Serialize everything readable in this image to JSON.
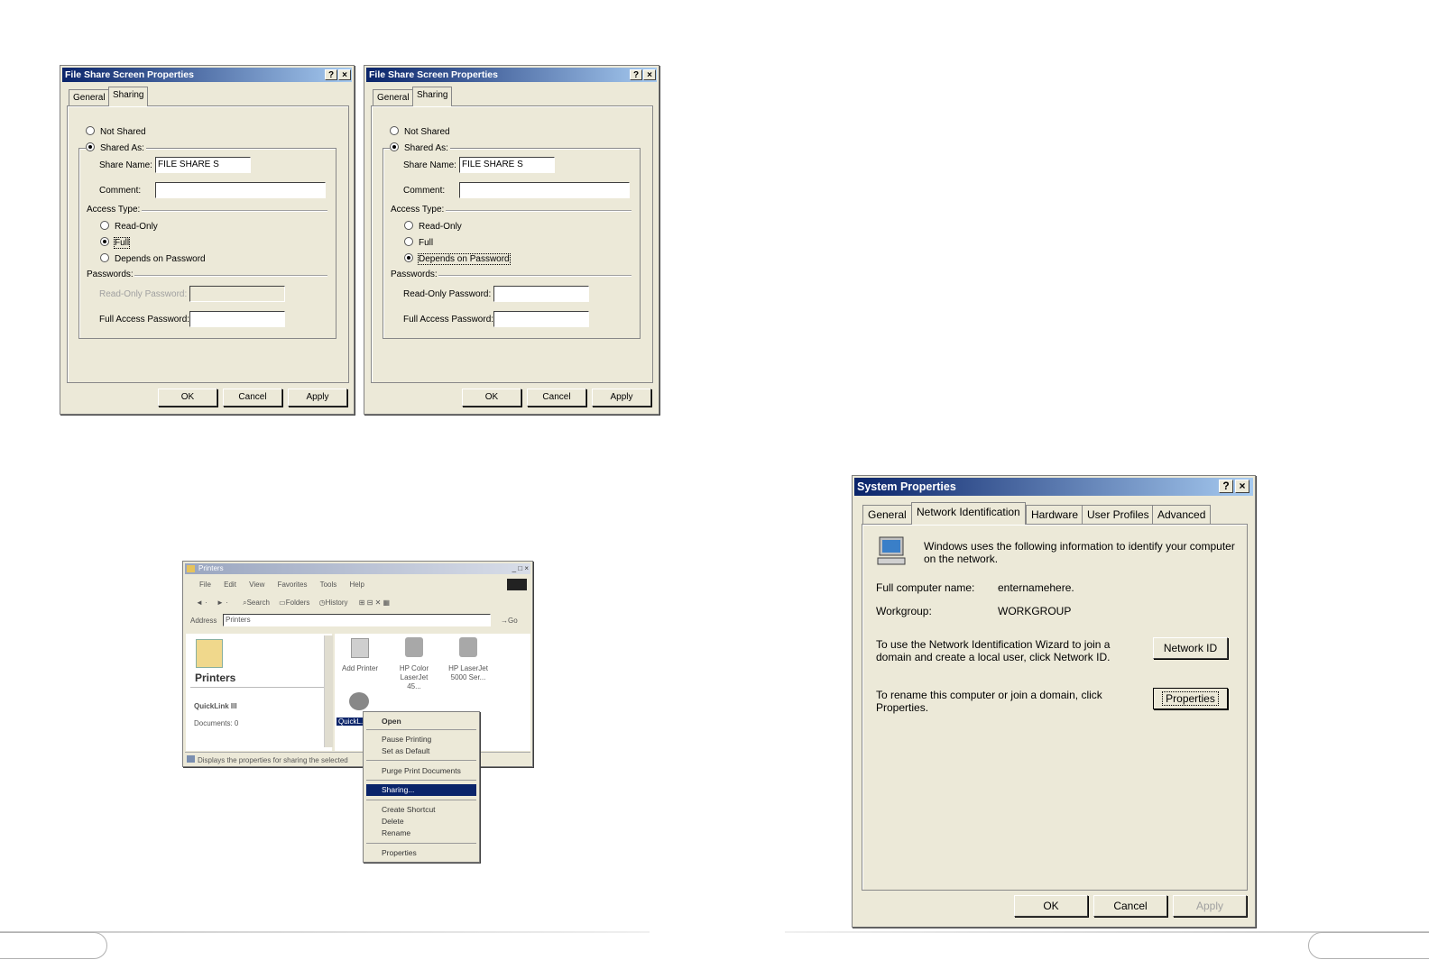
{
  "dialog_left": {
    "title": "File Share Screen Properties",
    "help_btn": "?",
    "close_btn": "×",
    "tabs": [
      "General",
      "Sharing"
    ],
    "not_shared": "Not Shared",
    "shared_as": "Shared As:",
    "share_name_label": "Share Name:",
    "share_name_value": "FILE SHARE S",
    "comment_label": "Comment:",
    "comment_value": "",
    "access_type_label": "Access Type:",
    "read_only": "Read-Only",
    "full": "Full",
    "depends": "Depends on Password",
    "passwords_label": "Passwords:",
    "ro_password_label": "Read-Only Password:",
    "full_password_label": "Full Access Password:",
    "selected_share": "Shared As:",
    "selected_access": "Full",
    "ok": "OK",
    "cancel": "Cancel",
    "apply": "Apply"
  },
  "dialog_right": {
    "title": "File Share Screen Properties",
    "help_btn": "?",
    "close_btn": "×",
    "tabs": [
      "General",
      "Sharing"
    ],
    "not_shared": "Not Shared",
    "shared_as": "Shared As:",
    "share_name_label": "Share Name:",
    "share_name_value": "FILE SHARE S",
    "comment_label": "Comment:",
    "comment_value": "",
    "access_type_label": "Access Type:",
    "read_only": "Read-Only",
    "full": "Full",
    "depends": "Depends on Password",
    "passwords_label": "Passwords:",
    "ro_password_label": "Read-Only Password:",
    "full_password_label": "Full Access Password:",
    "selected_share": "Shared As:",
    "selected_access": "Depends on Password",
    "ok": "OK",
    "cancel": "Cancel",
    "apply": "Apply"
  },
  "explorer": {
    "title": "Printers",
    "menu": [
      "File",
      "Edit",
      "View",
      "Favorites",
      "Tools",
      "Help"
    ],
    "toolbar": [
      "Search",
      "Folders",
      "History"
    ],
    "address_label": "Address",
    "address_value": "Printers",
    "go": "Go",
    "left_heading": "Printers",
    "left_item": "QuickLink III",
    "left_docs": "Documents: 0",
    "icons": [
      "Add Printer",
      "HP Color LaserJet 45...",
      "HP LaserJet 5000 Ser...",
      "QuickL..."
    ],
    "status": "Displays the properties for sharing the selected",
    "context_menu": [
      "Open",
      "Pause Printing",
      "Set as Default",
      "Purge Print Documents",
      "Sharing...",
      "Create Shortcut",
      "Delete",
      "Rename",
      "Properties"
    ],
    "highlighted": "Sharing..."
  },
  "system_properties": {
    "title": "System Properties",
    "help_btn": "?",
    "close_btn": "×",
    "tabs": [
      "General",
      "Network Identification",
      "Hardware",
      "User Profiles",
      "Advanced"
    ],
    "active_tab": "Network Identification",
    "intro_line1": "Windows uses the following information to identify your computer",
    "intro_line2": "on the network.",
    "full_name_label": "Full computer name:",
    "full_name_value": "enternamehere.",
    "workgroup_label": "Workgroup:",
    "workgroup_value": "WORKGROUP",
    "wizard_line1": "To use the Network Identification Wizard to join a",
    "wizard_line2": "domain and create a local user, click Network ID.",
    "network_id_btn": "Network ID",
    "rename_line1": "To rename this computer or join a domain, click",
    "rename_line2": "Properties.",
    "properties_btn": "Properties",
    "ok": "OK",
    "cancel": "Cancel",
    "apply": "Apply"
  },
  "colors": {
    "title_start": "#0a246a",
    "title_end": "#a6caf0",
    "face": "#ece9d8",
    "highlight": "#0a246a"
  }
}
